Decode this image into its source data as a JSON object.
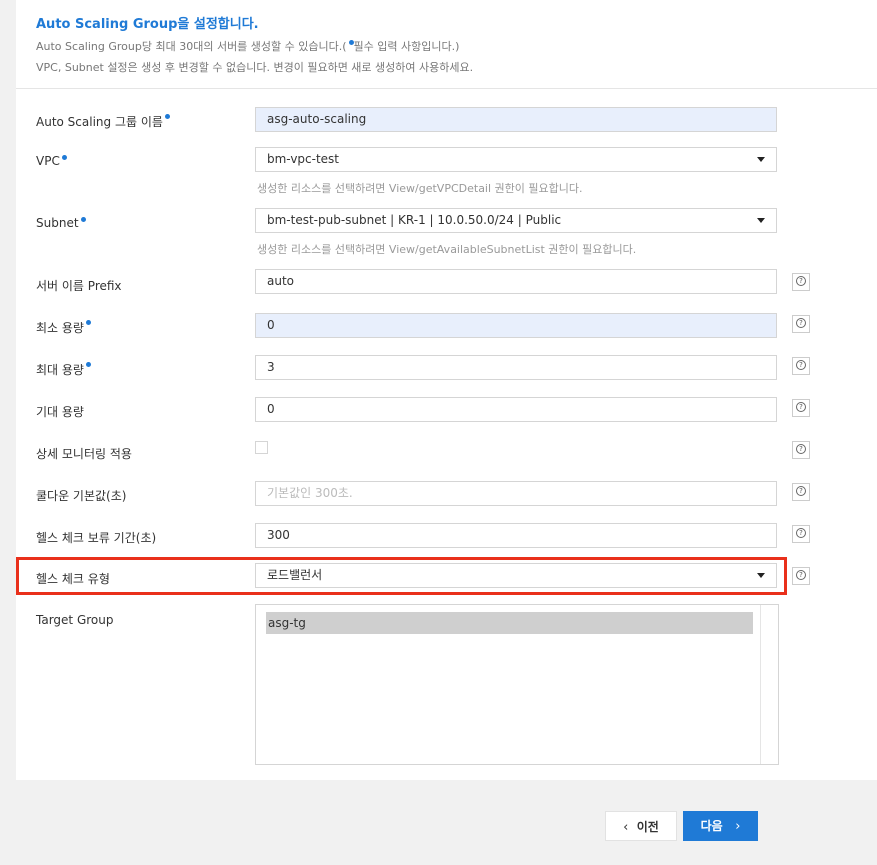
{
  "header": {
    "title": "Auto Scaling Group을 설정합니다.",
    "desc1_before": "Auto Scaling Group당 최대 30대의 서버를 생성할 수 있습니다.(",
    "desc1_after": "필수 입력 사항입니다.)",
    "desc2": "VPC, Subnet 설정은 생성 후 변경할 수 없습니다. 변경이 필요하면 새로 생성하여 사용하세요."
  },
  "form": {
    "asg_name": {
      "label": "Auto Scaling 그룹 이름",
      "value": "asg-auto-scaling"
    },
    "vpc": {
      "label": "VPC",
      "value": "bm-vpc-test",
      "hint": "생성한 리소스를 선택하려면 View/getVPCDetail 권한이 필요합니다."
    },
    "subnet": {
      "label": "Subnet",
      "value": "bm-test-pub-subnet | KR-1 | 10.0.50.0/24 | Public",
      "hint": "생성한 리소스를 선택하려면 View/getAvailableSubnetList 권한이 필요합니다."
    },
    "prefix": {
      "label": "서버 이름 Prefix",
      "value": "auto"
    },
    "min": {
      "label": "최소 용량",
      "value": "0"
    },
    "max": {
      "label": "최대 용량",
      "value": "3"
    },
    "desired": {
      "label": "기대 용량",
      "value": "0"
    },
    "monitoring": {
      "label": "상세 모니터링 적용",
      "checked": false
    },
    "cooldown": {
      "label": "쿨다운 기본값(초)",
      "placeholder": "기본값인 300초."
    },
    "grace": {
      "label": "헬스 체크 보류 기간(초)",
      "value": "300"
    },
    "health_type": {
      "label": "헬스 체크 유형",
      "value": "로드밸런서"
    },
    "target_group": {
      "label": "Target Group",
      "options": [
        "asg-tg"
      ]
    }
  },
  "help_icon_text": "?",
  "buttons": {
    "prev": "이전",
    "next": "다음"
  },
  "colors": {
    "accent": "#1f7ad6",
    "highlight": "#e9301b"
  }
}
